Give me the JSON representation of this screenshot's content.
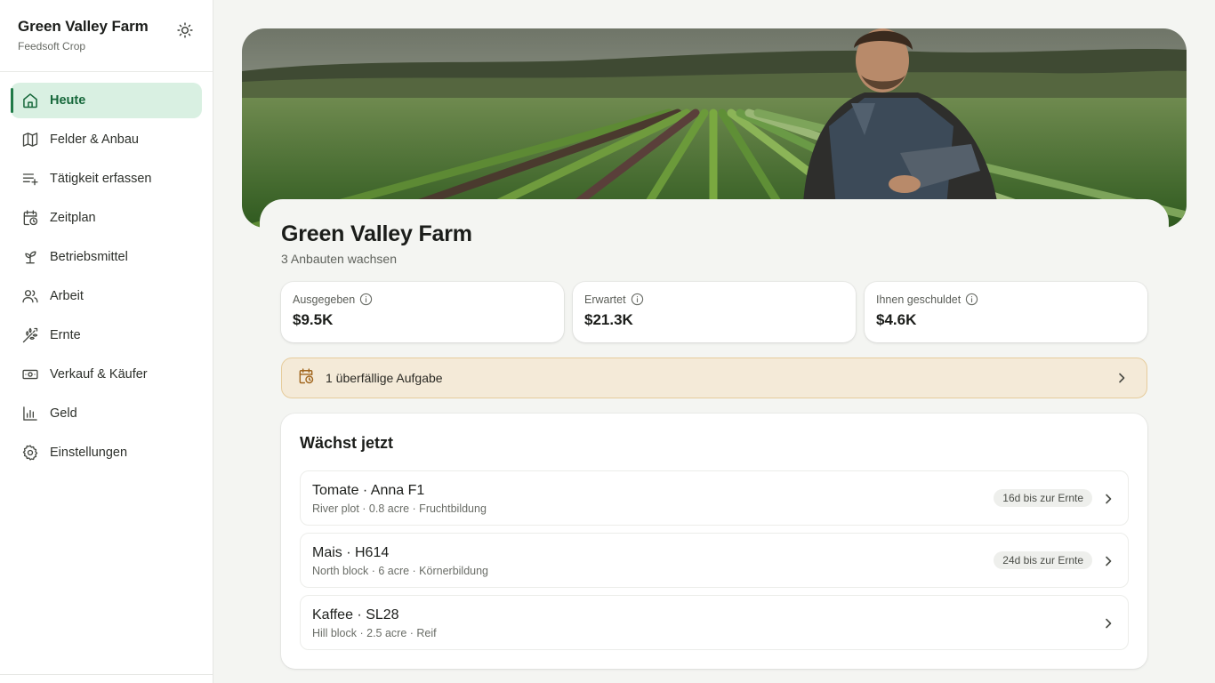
{
  "sidebar": {
    "brand_title": "Green Valley Farm",
    "brand_subtitle": "Feedsoft Crop",
    "theme_icon": "sun-icon",
    "items": [
      {
        "label": "Heute",
        "icon": "home-icon",
        "active": true
      },
      {
        "label": "Felder & Anbau",
        "icon": "map-icon"
      },
      {
        "label": "Tätigkeit erfassen",
        "icon": "list-plus-icon"
      },
      {
        "label": "Zeitplan",
        "icon": "calendar-clock-icon"
      },
      {
        "label": "Betriebsmittel",
        "icon": "sprout-icon"
      },
      {
        "label": "Arbeit",
        "icon": "users-icon"
      },
      {
        "label": "Ernte",
        "icon": "wheat-icon"
      },
      {
        "label": "Verkauf & Käufer",
        "icon": "banknote-icon"
      },
      {
        "label": "Geld",
        "icon": "bar-chart-icon"
      },
      {
        "label": "Einstellungen",
        "icon": "gear-icon"
      }
    ]
  },
  "main": {
    "title": "Green Valley Farm",
    "subtitle": "3 Anbauten wachsen",
    "stats": [
      {
        "label": "Ausgegeben",
        "value": "$9.5K"
      },
      {
        "label": "Erwartet",
        "value": "$21.3K"
      },
      {
        "label": "Ihnen geschuldet",
        "value": "$4.6K"
      }
    ],
    "alert": {
      "text": "1 überfällige Aufgabe",
      "icon": "calendar-clock-icon"
    },
    "growing": {
      "title": "Wächst jetzt",
      "crops": [
        {
          "name": "Tomate · Anna F1",
          "meta": "River plot · 0.8 acre · Fruchtbildung",
          "badge": "16d bis zur Ernte"
        },
        {
          "name": "Mais · H614",
          "meta": "North block · 6 acre · Körnerbildung",
          "badge": "24d bis zur Ernte"
        },
        {
          "name": "Kaffee · SL28",
          "meta": "Hill block · 2.5 acre · Reif",
          "badge": ""
        }
      ]
    }
  },
  "colors": {
    "accent": "#1f7a47",
    "active_bg": "#d9f0e2",
    "alert_bg": "#f4ead8",
    "alert_border": "#e6cc9c",
    "alert_icon": "#a0651c"
  }
}
